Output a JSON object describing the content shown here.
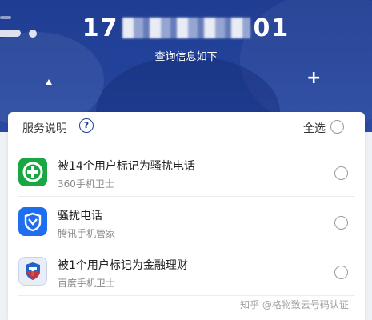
{
  "header": {
    "phone_prefix": "17",
    "phone_suffix": "01",
    "subtitle": "查询信息如下"
  },
  "card": {
    "service_label": "服务说明",
    "help_glyph": "?",
    "select_all_label": "全选"
  },
  "results": [
    {
      "title": "被14个用户标记为骚扰电话",
      "source": "360手机卫士",
      "icon": "360-security-icon",
      "color": "#1aa642"
    },
    {
      "title": "骚扰电话",
      "source": "腾讯手机管家",
      "icon": "tencent-manager-icon",
      "color": "#1f6ef0"
    },
    {
      "title": "被1个用户标记为金融理财",
      "source": "百度手机卫士",
      "icon": "baidu-guard-icon",
      "color": "#2062c8"
    }
  ],
  "watermark": "知乎 @格物致云号码认证"
}
